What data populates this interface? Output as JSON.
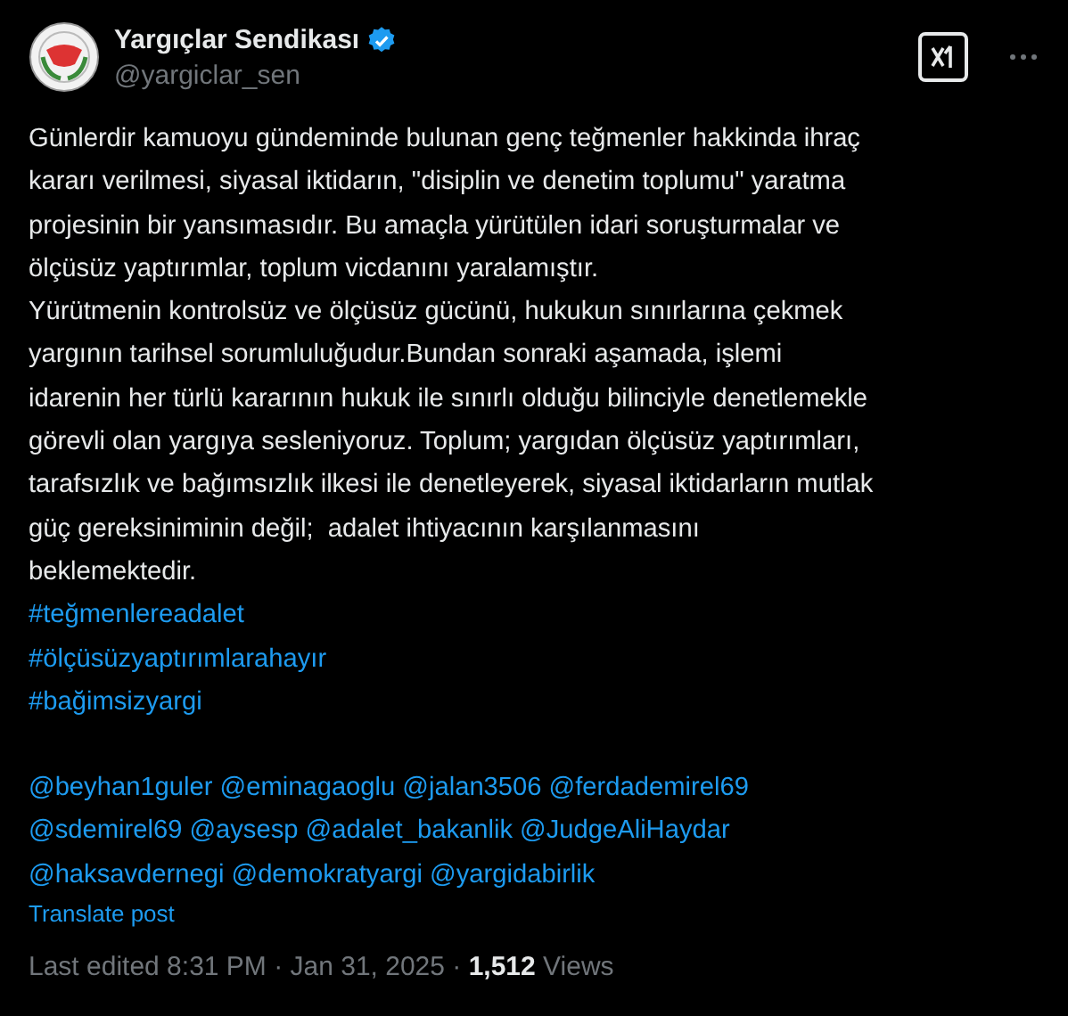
{
  "author": {
    "name": "Yargıçlar Sendikası",
    "verified": true,
    "handle": "@yargiclar_sen"
  },
  "body_lines": [
    "Günlerdir kamuoyu gündeminde bulunan genç teğmenler hakkinda ihraç",
    "kararı verilmesi, siyasal iktidarın, \"disiplin ve denetim toplumu\" yaratma",
    "projesinin bir yansımasıdır. Bu amaçla yürütülen idari soruşturmalar ve",
    "ölçüsüz yaptırımlar, toplum vicdanını yaralamıştır.",
    "Yürütmenin kontrolsüz ve ölçüsüz gücünü, hukukun sınırlarına çekmek",
    "yargının tarihsel sorumluluğudur.Bundan sonraki aşamada, işlemi",
    "idarenin her türlü kararının hukuk ile sınırlı olduğu bilinciyle denetlemekle",
    "görevli olan yargıya sesleniyoruz. Toplum; yargıdan ölçüsüz yaptırımları,",
    "tarafsızlık ve bağımsızlık ilkesi ile denetleyerek, siyasal iktidarların mutlak",
    "güç gereksiniminin değil;  adalet ihtiyacının karşılanmasını",
    "beklemektedir."
  ],
  "hashtags": [
    "#teğmenlereadalet",
    "#ölçüsüzyaptırımlarahayır",
    "#bağimsizyargi"
  ],
  "mention_lines": [
    [
      "@beyhan1guler",
      "@eminagaoglu",
      "@jalan3506",
      "@ferdademirel69"
    ],
    [
      "@sdemirel69",
      "@aysesp",
      "@adalet_bakanlik",
      "@JudgeAliHaydar"
    ],
    [
      "@haksavdernegi",
      "@demokratyargi",
      "@yargidabirlik"
    ]
  ],
  "translate": "Translate post",
  "footer": {
    "edited": "Last edited 8:31 PM · Jan 31, 2025 · ",
    "views_count": "1,512",
    "views_label": " Views"
  }
}
